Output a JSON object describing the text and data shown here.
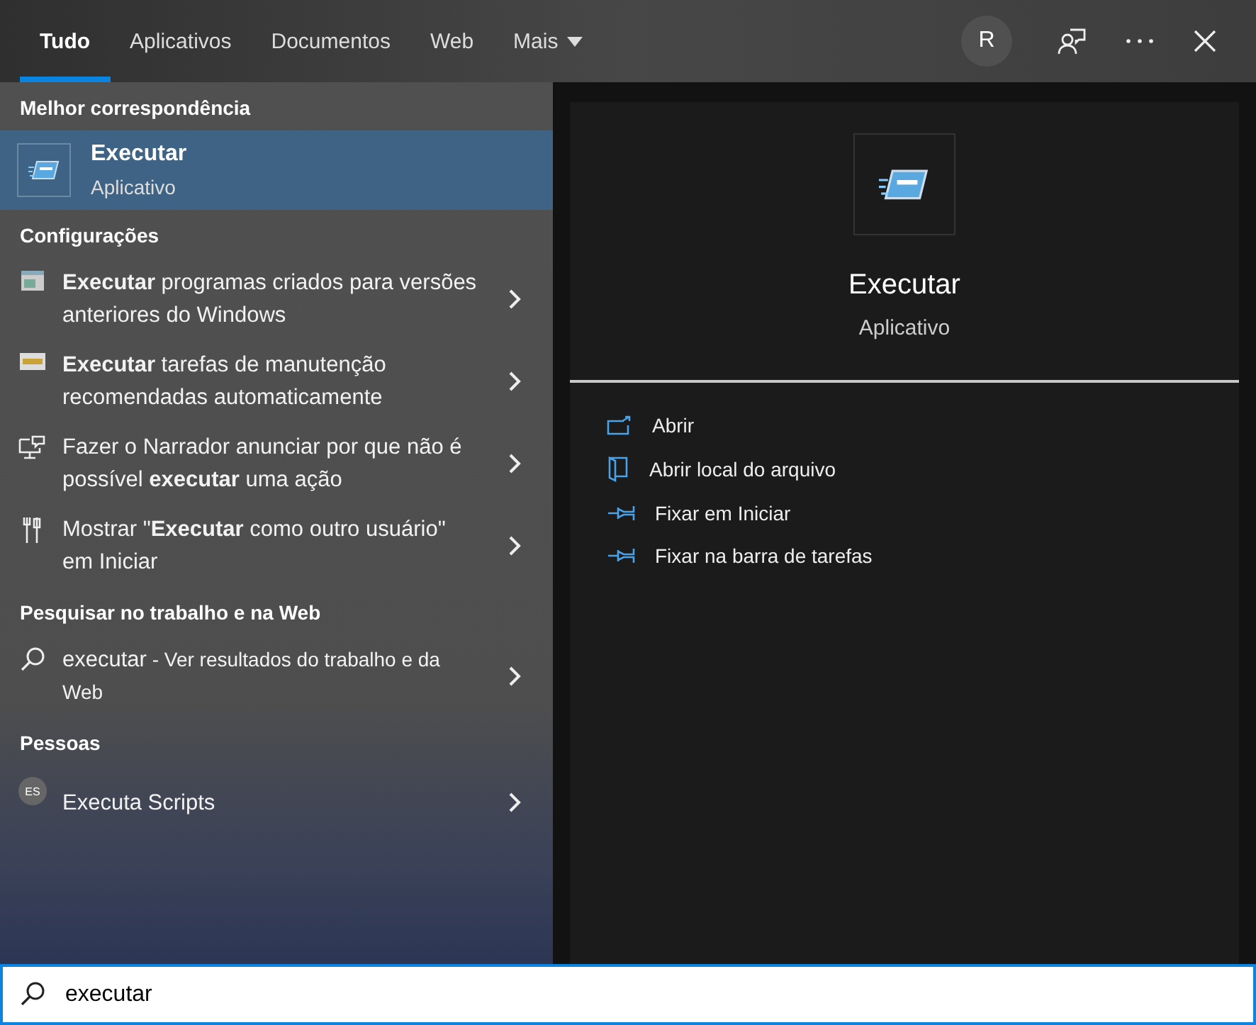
{
  "tabs": [
    {
      "label": "Tudo",
      "selected": true
    },
    {
      "label": "Aplicativos",
      "selected": false
    },
    {
      "label": "Documentos",
      "selected": false
    },
    {
      "label": "Web",
      "selected": false
    },
    {
      "label": "Mais",
      "selected": false,
      "dropdown": true
    }
  ],
  "account": {
    "initial": "R"
  },
  "best_match": {
    "heading": "Melhor correspondência",
    "title": "Executar",
    "subtitle": "Aplicativo",
    "selected": true
  },
  "sections": [
    {
      "heading": "Configurações",
      "items": [
        {
          "kind": "settings",
          "text": "**Executar** programas criados para versões anteriores do Windows"
        },
        {
          "kind": "settings",
          "text": "**Executar** tarefas de manutenção recomendadas automaticamente"
        },
        {
          "kind": "settings",
          "text": "Fazer o Narrador anunciar por que não é possível **executar** uma ação"
        },
        {
          "kind": "settings",
          "text": "Mostrar \"**Executar** como outro usuário\" em Iniciar"
        }
      ]
    },
    {
      "heading": "Pesquisar no trabalho e na Web",
      "items": [
        {
          "kind": "web",
          "query": "executar",
          "hint": " - Ver resultados do trabalho e da Web"
        }
      ]
    },
    {
      "heading": "Pessoas",
      "items": [
        {
          "kind": "person",
          "initials": "ES",
          "text": "Executa Scripts"
        }
      ]
    }
  ],
  "preview": {
    "title": "Executar",
    "subtitle": "Aplicativo"
  },
  "actions": [
    {
      "label": "Abrir"
    },
    {
      "label": "Abrir local do arquivo"
    },
    {
      "label": "Fixar em Iniciar"
    },
    {
      "label": "Fixar na barra de tarefas"
    }
  ],
  "search": {
    "value": "executar"
  }
}
